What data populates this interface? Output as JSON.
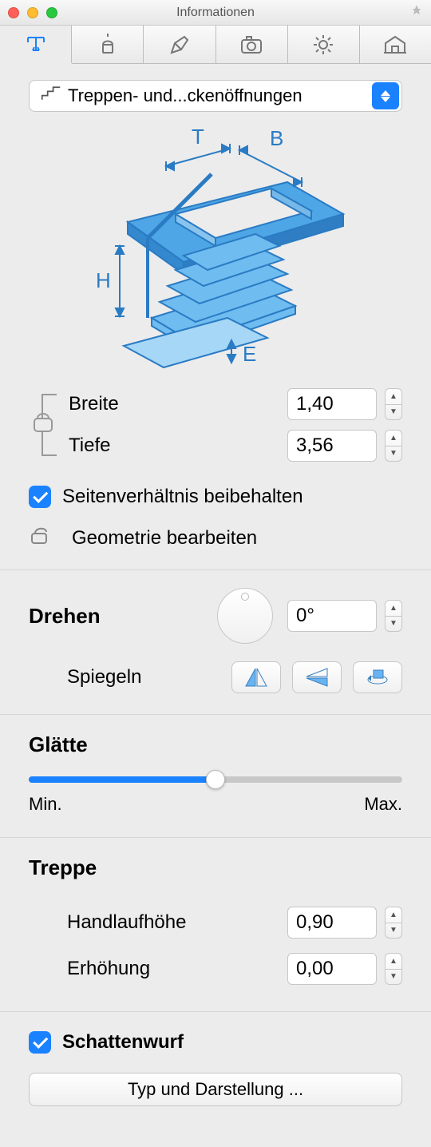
{
  "window": {
    "title": "Informationen"
  },
  "dropdown": {
    "label": "Treppen- und...ckenöffnungen"
  },
  "diagram_labels": {
    "T": "T",
    "B": "B",
    "H": "H",
    "E": "E"
  },
  "dims": {
    "width_label": "Breite",
    "width_value": "1,40",
    "depth_label": "Tiefe",
    "depth_value": "3,56"
  },
  "aspect": {
    "label": "Seitenverhältnis beibehalten"
  },
  "geometry": {
    "label": "Geometrie bearbeiten"
  },
  "rotate": {
    "label": "Drehen",
    "value": "0°",
    "mirror_label": "Spiegeln"
  },
  "smooth": {
    "label": "Glätte",
    "min": "Min.",
    "max": "Max."
  },
  "stairs": {
    "heading": "Treppe",
    "handrail_label": "Handlaufhöhe",
    "handrail_value": "0,90",
    "elevation_label": "Erhöhung",
    "elevation_value": "0,00"
  },
  "shadow": {
    "label": "Schattenwurf"
  },
  "type_button": {
    "label": "Typ und Darstellung ..."
  }
}
